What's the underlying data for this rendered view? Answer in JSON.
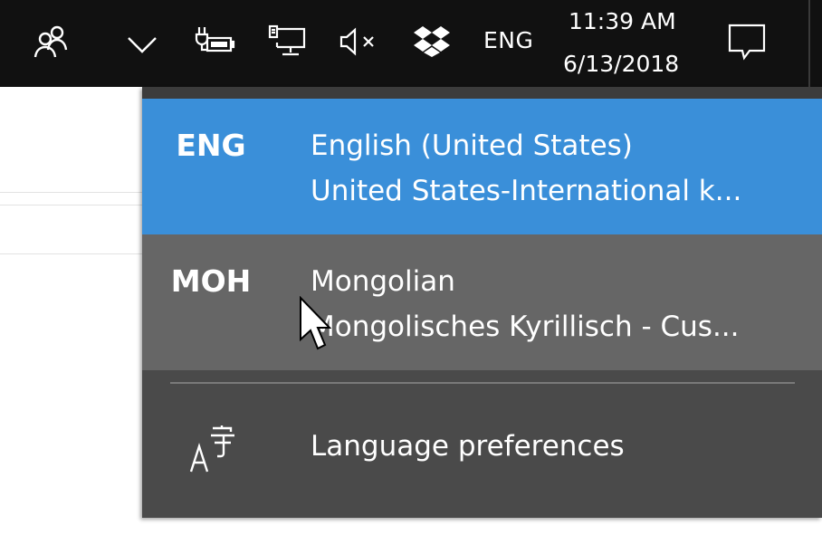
{
  "taskbar": {
    "icons": [
      "people-icon",
      "chevron-up-icon",
      "battery-charging-icon",
      "network-icon",
      "volume-muted-icon",
      "dropbox-icon",
      "action-center-icon"
    ],
    "input_indicator": "ENG",
    "clock": {
      "time": "11:39 AM",
      "date": "6/13/2018"
    }
  },
  "flyout": {
    "languages": [
      {
        "code": "ENG",
        "name": "English (United States)",
        "layout": "United States-International k...",
        "state": "selected"
      },
      {
        "code": "MOH",
        "name": "Mongolian",
        "layout": "Mongolisches Kyrillisch - Cus...",
        "state": "hover"
      }
    ],
    "preferences": {
      "label": "Language preferences",
      "icon": "language-preferences-icon"
    }
  },
  "colors": {
    "taskbar": "#111111",
    "flyout": "#4a4a4a",
    "selected": "#3a8fd9",
    "hover": "#666666"
  }
}
